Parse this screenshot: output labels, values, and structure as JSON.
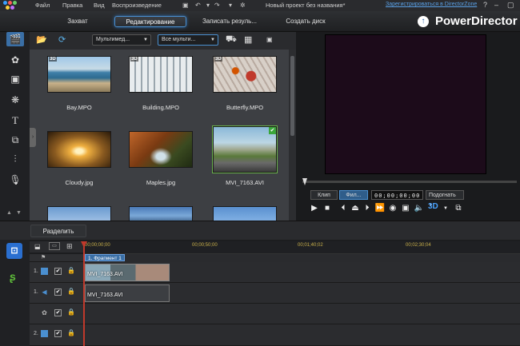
{
  "menu": {
    "items": [
      "Файл",
      "Правка",
      "Вид",
      "Воспроизведение"
    ],
    "project_title": "Новый проект без названия*",
    "register_link": "Зарегистрироваться в DirectorZone",
    "help": "?"
  },
  "modes": {
    "capture": "Захват",
    "edit": "Редактирование",
    "produce": "Записать резуль...",
    "create_disc": "Создать диск",
    "brand": "PowerDirector"
  },
  "media_toolbar": {
    "filter_dropdown": "Мультимед...",
    "scope_dropdown": "Все мульти..."
  },
  "library": {
    "items": [
      {
        "name": "Bay.MPO",
        "badge": "3D"
      },
      {
        "name": "Building.MPO",
        "badge": "3D"
      },
      {
        "name": "Butterfly.MPO",
        "badge": "3D"
      },
      {
        "name": "Cloudy.jpg",
        "badge": ""
      },
      {
        "name": "Maples.jpg",
        "badge": ""
      },
      {
        "name": "MVI_7163.AVI",
        "badge": ""
      }
    ]
  },
  "preview": {
    "clip_mode": "Клип",
    "film_mode": "Фил...",
    "timecode": "00;00;00;00",
    "fit": "Подогнать",
    "badge_3d": "3D"
  },
  "timeline": {
    "split_label": "Разделить",
    "ruler": [
      "00;00;00;00",
      "00;00;50;00",
      "00;01;40;02",
      "00;02;30;04"
    ],
    "chapter_label": "1. Фрагмент 1",
    "tracks": [
      {
        "number": "1.",
        "kind": "video"
      },
      {
        "number": "1.",
        "kind": "audio"
      },
      {
        "number": "",
        "kind": "fx"
      },
      {
        "number": "2.",
        "kind": "video"
      }
    ],
    "video_clip": "MVI_7163.AVI",
    "audio_clip": "MVI_7163.AVI"
  },
  "colors": {
    "accent": "#4a8fd0",
    "playhead": "#c0392b",
    "preview_bg": "#1c0b1a"
  }
}
